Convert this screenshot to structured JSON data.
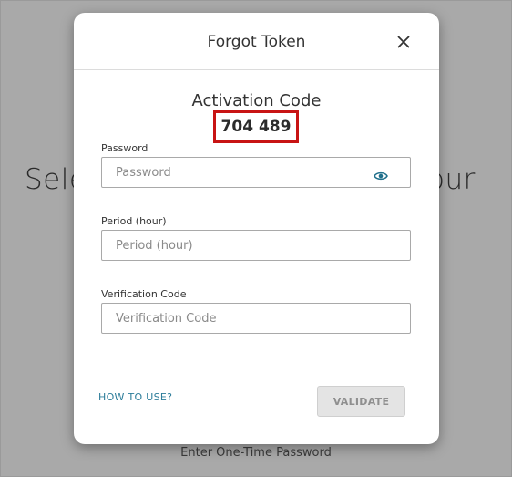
{
  "background": {
    "heading_left": "Sele",
    "heading_right": "our",
    "footer": "Enter One-Time Password"
  },
  "modal": {
    "title": "Forgot Token",
    "activation_label": "Activation Code",
    "activation_code": "704 489",
    "fields": [
      {
        "label": "Password",
        "placeholder": "Password",
        "value": ""
      },
      {
        "label": "Period (hour)",
        "placeholder": "Period (hour)",
        "value": ""
      },
      {
        "label": "Verification Code",
        "placeholder": "Verification Code",
        "value": ""
      }
    ],
    "how_to_use_label": "HOW TO USE?",
    "validate_label": "VALIDATE",
    "validate_enabled": false
  },
  "colors": {
    "overlay": "#a9a9a9",
    "highlight_border": "#c81414",
    "link": "#2d7d9a",
    "eye_icon": "#1f6f8b"
  },
  "icons": {
    "close": "close-icon",
    "password_visibility": "eye-icon"
  }
}
